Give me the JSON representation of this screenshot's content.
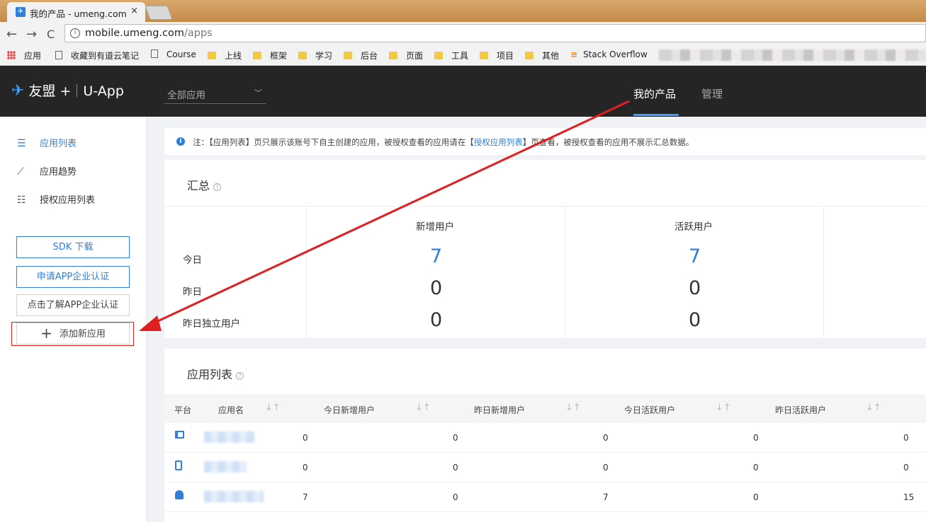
{
  "browser": {
    "tab_title": "我的产品 - umeng.com",
    "tab_close": "×",
    "url_host": "mobile.umeng.com",
    "url_path": "/apps",
    "back": "←",
    "forward": "→",
    "reload": "C",
    "bookmarks": [
      "应用",
      "收藏到有道云笔记",
      "Course",
      "上线",
      "框架",
      "学习",
      "后台",
      "页面",
      "工具",
      "项目",
      "其他",
      "Stack Overflow"
    ]
  },
  "header": {
    "logo_main": "友盟",
    "logo_plus": "+",
    "logo_product": "U-App",
    "app_select": "全部应用",
    "nav_my_products": "我的产品",
    "nav_manage": "管理"
  },
  "sidebar": {
    "items": [
      {
        "label": "应用列表",
        "icon": "list-icon",
        "active": true
      },
      {
        "label": "应用趋势",
        "icon": "trend-icon",
        "active": false
      },
      {
        "label": "授权应用列表",
        "icon": "checklist-icon",
        "active": false
      }
    ],
    "sdk_button": "SDK 下载",
    "cert_button": "申请APP企业认证",
    "learn_button": "点击了解APP企业认证",
    "add_button": "添加新应用"
  },
  "notice": {
    "prefix": "注：【应用列表】页只展示该账号下自主创建的应用，被授权查看的应用请在【",
    "link": "授权应用列表",
    "suffix": "】页查看，被授权查看的应用不展示汇总数据。"
  },
  "summary": {
    "title": "汇总",
    "row_labels": [
      "今日",
      "昨日",
      "昨日独立用户"
    ],
    "columns": [
      {
        "label": "新增用户",
        "values": [
          "7",
          "0",
          "0"
        ]
      },
      {
        "label": "活跃用户",
        "values": [
          "7",
          "0",
          "0"
        ]
      }
    ]
  },
  "app_list": {
    "title": "应用列表",
    "headers": [
      "平台",
      "应用名",
      "今日新增用户",
      "昨日新增用户",
      "今日活跃用户",
      "昨日活跃用户"
    ],
    "rows": [
      {
        "platform": "ipad-icon",
        "values": [
          "0",
          "0",
          "0",
          "0",
          "0"
        ]
      },
      {
        "platform": "iphone-icon",
        "values": [
          "0",
          "0",
          "0",
          "0",
          "0"
        ]
      },
      {
        "platform": "android-icon",
        "values": [
          "7",
          "0",
          "7",
          "0",
          "15"
        ]
      }
    ]
  },
  "colors": {
    "accent": "#2f7fd8",
    "header_bg": "#252525",
    "annotation_red": "#e02020"
  }
}
